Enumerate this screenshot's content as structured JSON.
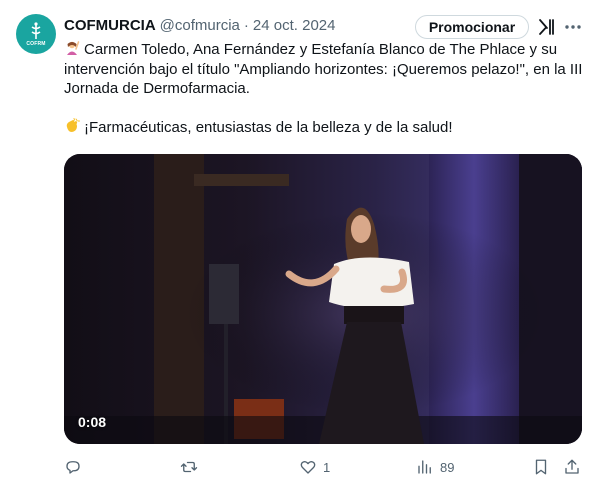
{
  "tweet": {
    "author_name": "COFMURCIA",
    "handle": "@cofmurcia",
    "separator": "·",
    "date": "24 oct. 2024",
    "avatar_text": "COFRM",
    "promote_label": "Promocionar",
    "text_line1": "Carmen Toledo, Ana Fernández y Estefanía Blanco de The Phlace y su intervención bajo el título \"Ampliando horizontes: ¡Queremos pelazo!\", en la III Jornada de Dermofarmacia.",
    "text_line2": "¡Farmacéuticas, entusiastas de la belleza y de la salud!",
    "emoji1": "woman-raising-hand-emoji",
    "emoji2": "clapping-hands-emoji"
  },
  "video": {
    "time": "0:08"
  },
  "actions": {
    "reply_count": "",
    "retweet_count": "",
    "like_count": "1",
    "views_count": "89"
  },
  "colors": {
    "accent": "#1aa5a0",
    "text_primary": "#0f1419",
    "text_secondary": "#536471",
    "border": "#cfd9de"
  }
}
